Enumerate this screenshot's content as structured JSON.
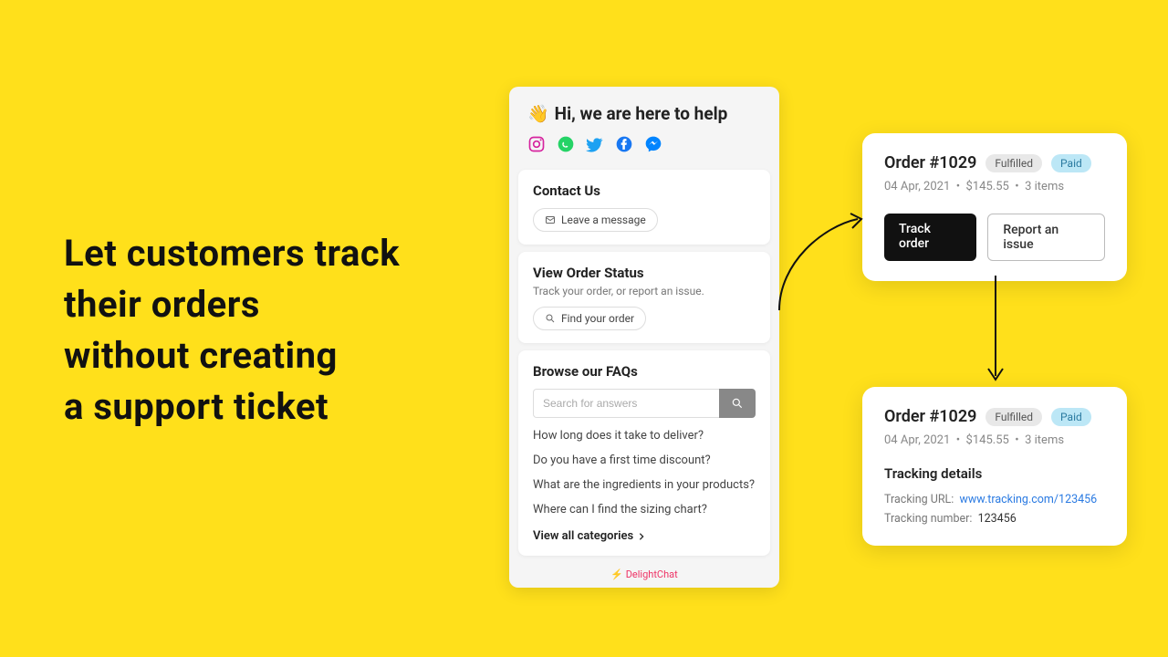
{
  "headline": {
    "l1": "Let customers track",
    "l2": "their orders",
    "l3": "without creating",
    "l4": "a support ticket"
  },
  "widget": {
    "wave": "👋",
    "title": "Hi, we are here to help",
    "contact": {
      "heading": "Contact Us",
      "leave_label": "Leave a message"
    },
    "order_status": {
      "heading": "View Order Status",
      "sub": "Track your order, or report an issue.",
      "find_label": "Find your order"
    },
    "faqs": {
      "heading": "Browse our FAQs",
      "placeholder": "Search for answers",
      "items": [
        "How long does it take to deliver?",
        "Do you have a first time discount?",
        "What are the ingredients in your products?",
        "Where can I find the sizing chart?"
      ],
      "view_all": "View all categories"
    },
    "footer": "DelightChat"
  },
  "order": {
    "title": "Order #1029",
    "fulfilled": "Fulfilled",
    "paid": "Paid",
    "date": "04 Apr, 2021",
    "amount": "$145.55",
    "items": "3 items",
    "track_btn": "Track order",
    "report_btn": "Report an issue",
    "tracking": {
      "heading": "Tracking details",
      "url_label": "Tracking URL:",
      "url": "www.tracking.com/123456",
      "num_label": "Tracking number:",
      "num": "123456"
    }
  }
}
